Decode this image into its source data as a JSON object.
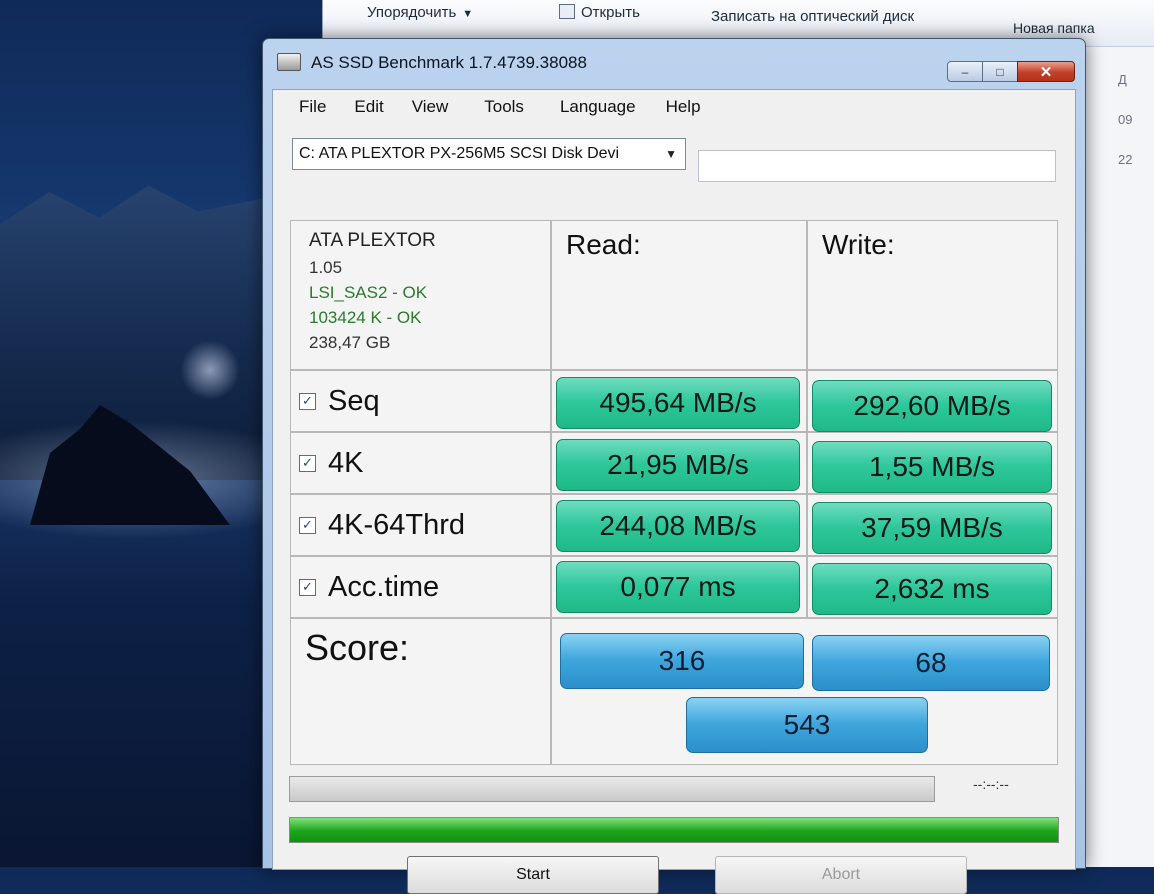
{
  "explorer": {
    "toolbar": {
      "organize": "Упорядочить",
      "open": "Открыть",
      "burn": "Записать на оптический диск",
      "new_folder": "Новая папка"
    },
    "list_fragments": [
      "Д",
      "09",
      "22"
    ]
  },
  "window": {
    "title": "AS SSD Benchmark 1.7.4739.38088",
    "controls": {
      "minimize": "–",
      "maximize": "□",
      "close": "✕"
    }
  },
  "menu": [
    "File",
    "Edit",
    "View",
    "Tools",
    "Language",
    "Help"
  ],
  "drive": {
    "selected": "C: ATA PLEXTOR PX-256M5 SCSI Disk Devi",
    "arrow": "▼"
  },
  "info": {
    "name": "ATA PLEXTOR",
    "version": "1.05",
    "driver": "LSI_SAS2 - OK",
    "alignment": "103424 K - OK",
    "size": "238,47 GB"
  },
  "columns": {
    "read": "Read:",
    "write": "Write:"
  },
  "rows": [
    {
      "label": "Seq",
      "checked": true,
      "read": "495,64 MB/s",
      "write": "292,60 MB/s"
    },
    {
      "label": "4K",
      "checked": true,
      "read": "21,95 MB/s",
      "write": "1,55 MB/s"
    },
    {
      "label": "4K-64Thrd",
      "checked": true,
      "read": "244,08 MB/s",
      "write": "37,59 MB/s"
    },
    {
      "label": "Acc.time",
      "checked": true,
      "read": "0,077 ms",
      "write": "2,632 ms"
    }
  ],
  "checkmark": "✓",
  "score": {
    "label": "Score:",
    "read": "316",
    "write": "68",
    "total": "543"
  },
  "progress": {
    "timer": "--:--:--",
    "bottom_percent": 100
  },
  "buttons": {
    "start": "Start",
    "abort": "Abort"
  },
  "colors": {
    "result_green": "#2ec79b",
    "score_blue": "#3fa6dc",
    "progress_green": "#1ea51a"
  }
}
